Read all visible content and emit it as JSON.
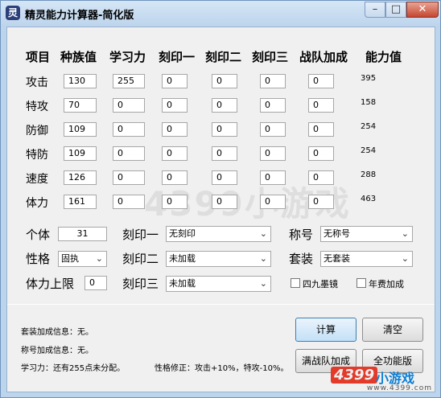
{
  "window": {
    "title": "精灵能力计算器-简化版",
    "icon_letter": "灵",
    "min": "–",
    "max": "□",
    "close": "✕"
  },
  "table": {
    "headers": [
      "项目",
      "种族值",
      "学习力",
      "刻印一",
      "刻印二",
      "刻印三",
      "战队加成",
      "能力值"
    ],
    "rows": [
      {
        "label": "攻击",
        "values": [
          "130",
          "255",
          "0",
          "0",
          "0",
          "0"
        ],
        "result": "395"
      },
      {
        "label": "特攻",
        "values": [
          "70",
          "0",
          "0",
          "0",
          "0",
          "0"
        ],
        "result": "158"
      },
      {
        "label": "防御",
        "values": [
          "109",
          "0",
          "0",
          "0",
          "0",
          "0"
        ],
        "result": "254"
      },
      {
        "label": "特防",
        "values": [
          "109",
          "0",
          "0",
          "0",
          "0",
          "0"
        ],
        "result": "254"
      },
      {
        "label": "速度",
        "values": [
          "126",
          "0",
          "0",
          "0",
          "0",
          "0"
        ],
        "result": "288"
      },
      {
        "label": "体力",
        "values": [
          "161",
          "0",
          "0",
          "0",
          "0",
          "0"
        ],
        "result": "463"
      }
    ]
  },
  "controls": {
    "individual_label": "个体",
    "individual_value": "31",
    "nature_label": "性格",
    "nature_value": "固执",
    "hp_limit_label": "体力上限",
    "hp_limit_value": "0",
    "imprint1_label": "刻印一",
    "imprint1_value": "无刻印",
    "imprint2_label": "刻印二",
    "imprint2_value": "未加载",
    "imprint3_label": "刻印三",
    "imprint3_value": "未加载",
    "title_label": "称号",
    "title_value": "无称号",
    "suit_label": "套装",
    "suit_value": "无套装",
    "check_jiujiu": "四九墨镜",
    "check_annual": "年费加成"
  },
  "info": {
    "suit_info": "套装加成信息：无。",
    "title_info": "称号加成信息：无。",
    "learning_info": "学习力：还有255点未分配。",
    "nature_info": "性格修正：攻击+10%，特攻-10%。"
  },
  "buttons": {
    "calc": "计算",
    "clear": "清空",
    "full_team": "满战队加成",
    "full_version": "全功能版"
  },
  "watermark": "4399小游戏",
  "logo": {
    "number": "4399",
    "text": "小游戏",
    "url": "www.4399.com"
  }
}
